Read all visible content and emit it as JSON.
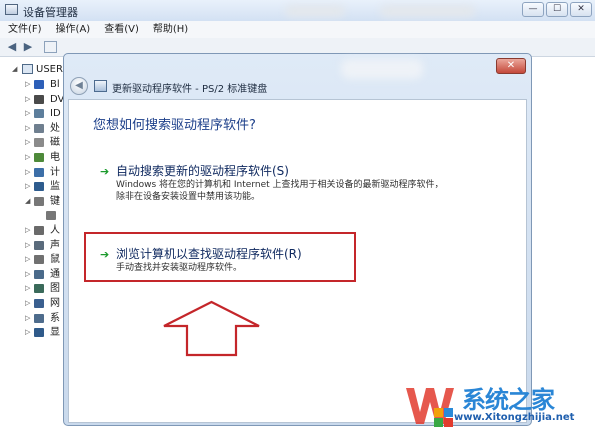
{
  "background_window": {
    "title": "设备管理器",
    "window_buttons": {
      "minimize": "—",
      "maximize": "☐",
      "close": "✕"
    },
    "menu": [
      {
        "label": "文件(F)"
      },
      {
        "label": "操作(A)"
      },
      {
        "label": "查看(V)"
      },
      {
        "label": "帮助(H)"
      }
    ],
    "tree": {
      "root_label": "USER",
      "items": [
        {
          "label": "Bl",
          "icon": "bluetooth-icon",
          "color": "#2d5fb8"
        },
        {
          "label": "DV",
          "icon": "dvd-drive-icon",
          "color": "#4a4a4a"
        },
        {
          "label": "ID",
          "icon": "ide-controller-icon",
          "color": "#5d7e9c"
        },
        {
          "label": "处",
          "icon": "processor-icon",
          "color": "#6f7f8f"
        },
        {
          "label": "磁",
          "icon": "disk-drive-icon",
          "color": "#8b8b8b"
        },
        {
          "label": "电",
          "icon": "battery-icon",
          "color": "#4e8a3a"
        },
        {
          "label": "计",
          "icon": "computer-icon",
          "color": "#3c6fa8"
        },
        {
          "label": "监",
          "icon": "monitor-icon",
          "color": "#2e5c8e"
        },
        {
          "label": "键",
          "icon": "keyboard-icon",
          "color": "#777777"
        },
        {
          "label": "",
          "icon": "keyboard-device-icon",
          "color": "#777777"
        },
        {
          "label": "人",
          "icon": "hid-icon",
          "color": "#6a6a6a"
        },
        {
          "label": "声",
          "icon": "sound-icon",
          "color": "#5a6b7c"
        },
        {
          "label": "鼠",
          "icon": "mouse-icon",
          "color": "#707070"
        },
        {
          "label": "通",
          "icon": "usb-controller-icon",
          "color": "#4a6a8a"
        },
        {
          "label": "图",
          "icon": "imaging-device-icon",
          "color": "#3a6a5a"
        },
        {
          "label": "网",
          "icon": "network-adapter-icon",
          "color": "#3a5f8f"
        },
        {
          "label": "系",
          "icon": "system-device-icon",
          "color": "#4e6c8c"
        },
        {
          "label": "显",
          "icon": "display-adapter-icon",
          "color": "#2f5a8a"
        }
      ]
    }
  },
  "dialog": {
    "close_label": "✕",
    "title": "更新驱动程序软件 - PS/2 标准键盘",
    "question": "您想如何搜索驱动程序软件?",
    "options": [
      {
        "title": "自动搜索更新的驱动程序软件(S)",
        "description": "Windows 将在您的计算机和 Internet 上查找用于相关设备的最新驱动程序软件，除非在设备安装设置中禁用该功能。"
      },
      {
        "title": "浏览计算机以查找驱动程序软件(R)",
        "description": "手动查找并安装驱动程序软件。"
      }
    ],
    "colors": {
      "highlight_box": "#c4262a",
      "annotation_arrow": "#c4262a",
      "option_arrow": "#1b9a2c"
    }
  },
  "watermark": {
    "brand": "系统之家",
    "url": "www.Xitongzhijia.net"
  }
}
